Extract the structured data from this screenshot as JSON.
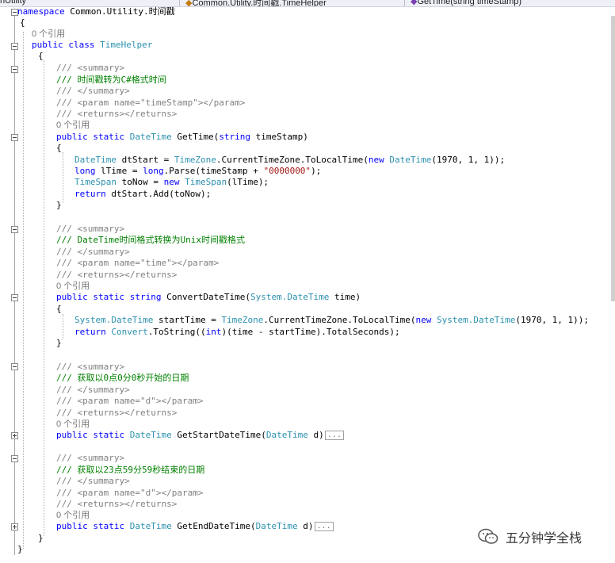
{
  "tabs": [
    {
      "label": "nUtility",
      "icon": "file-icon"
    },
    {
      "label": "Common.Utility.时间戳.TimeHelper",
      "icon": "class-icon"
    },
    {
      "label": "GetTime(string timeStamp)",
      "icon": "method-icon"
    }
  ],
  "code": {
    "ns_kw": "namespace",
    "ns_name": " Common.Utility.时间戳",
    "brace_open": "{",
    "brace_close": "}",
    "ref0": "0 个引用",
    "class_kw": "public class ",
    "class_name": "TimeHelper",
    "m1_c1": "/// <summary>",
    "m1_c2": "/// 时间戳转为C#格式时间",
    "m1_c3": "/// </summary>",
    "m1_c4": "/// <param name=\"timeStamp\"></param>",
    "m1_c5": "/// <returns></returns>",
    "m1_sig_kw": "public static ",
    "m1_sig_type": "DateTime",
    "m1_sig_rest": " GetTime(",
    "m1_sig_kw2": "string",
    "m1_sig_end": " timeStamp)",
    "m1_l1_type": "DateTime",
    "m1_l1_a": " dtStart = ",
    "m1_l1_type2": "TimeZone",
    "m1_l1_b": ".CurrentTimeZone.ToLocalTime(",
    "m1_l1_kw": "new",
    "m1_l1_type3": " DateTime",
    "m1_l1_c": "(1970, 1, 1));",
    "m1_l2_kw": "long",
    "m1_l2_a": " lTime = ",
    "m1_l2_kw2": "long",
    "m1_l2_b": ".Parse(timeStamp + ",
    "m1_l2_str": "\"0000000\"",
    "m1_l2_c": ");",
    "m1_l3_type": "TimeSpan",
    "m1_l3_a": " toNow = ",
    "m1_l3_kw": "new",
    "m1_l3_type2": " TimeSpan",
    "m1_l3_b": "(lTime);",
    "m1_l4_kw": "return",
    "m1_l4_a": " dtStart.Add(toNow);",
    "m2_c1": "/// <summary>",
    "m2_c2": "/// DateTime时间格式转换为Unix时间戳格式",
    "m2_c3": "/// </summary>",
    "m2_c4": "/// <param name=\"time\"></param>",
    "m2_c5": "/// <returns></returns>",
    "m2_sig_kw": "public static string",
    "m2_sig_rest": " ConvertDateTime(",
    "m2_sig_type": "System.DateTime",
    "m2_sig_end": " time)",
    "m2_l1_type": "System.DateTime",
    "m2_l1_a": " startTime = ",
    "m2_l1_type2": "TimeZone",
    "m2_l1_b": ".CurrentTimeZone.ToLocalTime(",
    "m2_l1_kw": "new",
    "m2_l1_type3": " System.DateTime",
    "m2_l1_c": "(1970, 1, 1));",
    "m2_l2_kw": "return",
    "m2_l2_type": " Convert",
    "m2_l2_a": ".ToString((",
    "m2_l2_kw2": "int",
    "m2_l2_b": ")(time - startTime).TotalSeconds);",
    "m3_c1": "/// <summary>",
    "m3_c2": "/// 获取以0点0分0秒开始的日期",
    "m3_c3": "/// </summary>",
    "m3_c4": "/// <param name=\"d\"></param>",
    "m3_c5": "/// <returns></returns>",
    "m3_sig_kw": "public static ",
    "m3_sig_type": "DateTime",
    "m3_sig_rest": " GetStartDateTime(",
    "m3_sig_type2": "DateTime",
    "m3_sig_end": " d)",
    "m4_c1": "/// <summary>",
    "m4_c2": "/// 获取以23点59分59秒结束的日期",
    "m4_c3": "/// </summary>",
    "m4_c4": "/// <param name=\"d\"></param>",
    "m4_c5": "/// <returns></returns>",
    "m4_sig_kw": "public static ",
    "m4_sig_type": "DateTime",
    "m4_sig_rest": " GetEndDateTime(",
    "m4_sig_type2": "DateTime",
    "m4_sig_end": " d)",
    "collapsed_marker": "..."
  },
  "watermark": {
    "text": "五分钟学全栈",
    "icon": "wechat-icon"
  },
  "colors": {
    "keyword": "#0000ff",
    "type": "#2b91af",
    "comment": "#008000",
    "string": "#a31515"
  }
}
